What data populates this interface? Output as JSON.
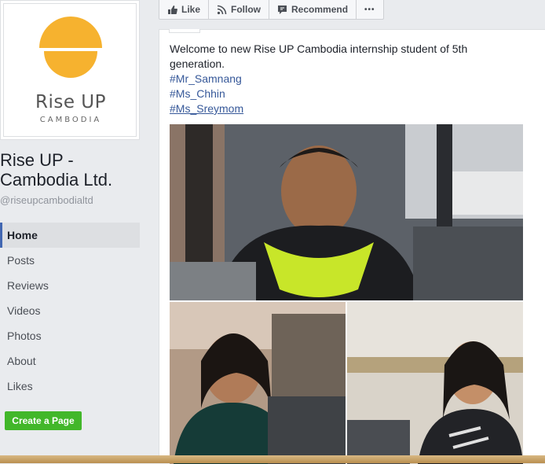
{
  "logo": {
    "brand_line1": "Rise UP",
    "brand_line2": "CAMBODIA",
    "colors": {
      "sun": "#f6b22f"
    }
  },
  "page": {
    "name": "Rise UP - Cambodia Ltd.",
    "handle": "@riseupcambodialtd"
  },
  "nav": {
    "items": [
      {
        "label": "Home",
        "active": true
      },
      {
        "label": "Posts"
      },
      {
        "label": "Reviews"
      },
      {
        "label": "Videos"
      },
      {
        "label": "Photos"
      },
      {
        "label": "About"
      },
      {
        "label": "Likes"
      }
    ]
  },
  "create_page_label": "Create a Page",
  "actions": {
    "like": {
      "label": "Like",
      "icon": "thumbs-up-icon"
    },
    "follow": {
      "label": "Follow",
      "icon": "rss-icon"
    },
    "recommend": {
      "label": "Recommend",
      "icon": "speech-bubble-icon"
    },
    "more": {
      "label": "•••",
      "icon": "more-icon"
    }
  },
  "post": {
    "text": "Welcome to new Rise UP Cambodia internship student of 5th generation.",
    "hashtags": [
      "#Mr_Samnang",
      "#Ms_Chhin",
      "#Ms_Sreymom"
    ]
  },
  "colors": {
    "accent_blue": "#4267b2",
    "link": "#365899",
    "create_button": "#42b72a"
  }
}
